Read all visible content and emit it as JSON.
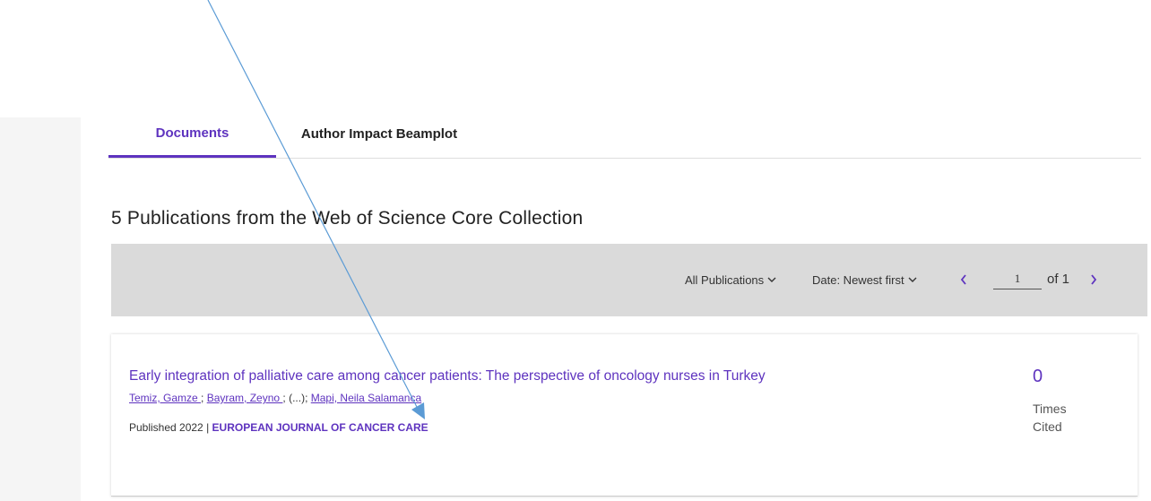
{
  "tabs": [
    {
      "label": "Documents",
      "active": true
    },
    {
      "label": "Author Impact Beamplot",
      "active": false
    }
  ],
  "heading": "5 Publications from the Web of Science Core Collection",
  "toolbar": {
    "filter_label": "All Publications",
    "sort_label": "Date: Newest first",
    "prev_icon": "chevron-left-icon",
    "next_icon": "chevron-right-icon",
    "current_page": "1",
    "of_label": "of 1"
  },
  "results": [
    {
      "title": "Early integration of palliative care among cancer patients: The perspective of oncology nurses in Turkey",
      "authors": [
        "Temiz, Gamze ",
        "Bayram, Zeyno ",
        "Mapi, Neila Salamanca"
      ],
      "authors_sep1": ";",
      "authors_sep2": "; (...); ",
      "published": "Published 2022 |",
      "journal": "EUROPEAN JOURNAL OF CANCER CARE",
      "cite_count": "0",
      "cite_label_1": "Times",
      "cite_label_2": "Cited"
    }
  ],
  "colors": {
    "accent": "#5e33bf",
    "toolbar_bg": "#dadada",
    "annotation": "#5b9bd5"
  }
}
